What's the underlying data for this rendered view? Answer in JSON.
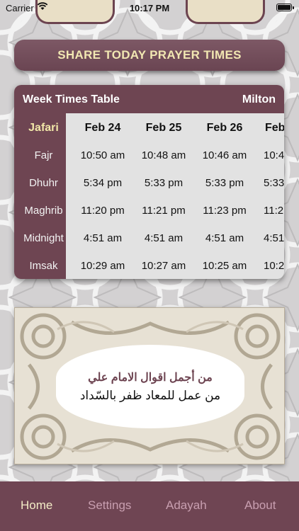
{
  "status_bar": {
    "carrier": "Carrier",
    "time": "10:17 PM"
  },
  "share_button": {
    "label": "SHARE TODAY PRAYER TIMES"
  },
  "week_table": {
    "title": "Week Times Table",
    "city": "Milton",
    "school": "Jafari",
    "dates": [
      "Feb 24",
      "Feb 25",
      "Feb 26",
      "Feb"
    ],
    "rows": [
      {
        "name": "Fajr",
        "times": [
          "10:50 am",
          "10:48 am",
          "10:46 am",
          "10:4"
        ]
      },
      {
        "name": "Dhuhr",
        "times": [
          "5:34 pm",
          "5:33 pm",
          "5:33 pm",
          "5:33"
        ]
      },
      {
        "name": "Maghrib",
        "times": [
          "11:20 pm",
          "11:21 pm",
          "11:23 pm",
          "11:2"
        ]
      },
      {
        "name": "Midnight",
        "times": [
          "4:51 am",
          "4:51 am",
          "4:51 am",
          "4:51"
        ]
      },
      {
        "name": "Imsak",
        "times": [
          "10:29 am",
          "10:27 am",
          "10:25 am",
          "10:2"
        ]
      }
    ]
  },
  "quote": {
    "title": "من أجمل اقوال الامام علي",
    "text": "من عمل للمعاد ظفر بالسّداد"
  },
  "tabs": [
    {
      "label": "Home",
      "active": true
    },
    {
      "label": "Settings",
      "active": false
    },
    {
      "label": "Adayah",
      "active": false
    },
    {
      "label": "About",
      "active": false
    }
  ],
  "colors": {
    "primary": "#6e4552",
    "accent_text": "#f1e7b2",
    "inactive_tab": "#c89fb0"
  },
  "icons": [
    "wifi-icon",
    "battery-icon"
  ]
}
